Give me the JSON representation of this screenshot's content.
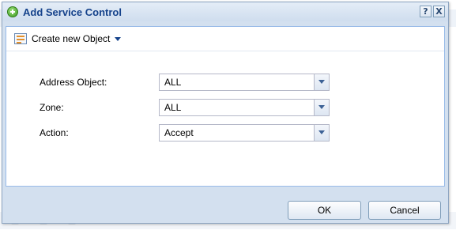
{
  "dialog": {
    "title": "Add Service Control",
    "help_label": "?",
    "close_label": "X"
  },
  "toolbar": {
    "create_label": "Create new Object"
  },
  "form": {
    "address_object": {
      "label": "Address Object:",
      "value": "ALL"
    },
    "zone": {
      "label": "Zone:",
      "value": "ALL"
    },
    "action": {
      "label": "Action:",
      "value": "Accept"
    }
  },
  "buttons": {
    "ok": "OK",
    "cancel": "Cancel"
  },
  "colors": {
    "title_text": "#15428b",
    "dialog_frame": "#d3e0ef",
    "panel_border": "#99bbe8"
  },
  "icons": {
    "title": "add-circle-icon",
    "create": "object-list-icon",
    "dropdown": "chevron-down-icon"
  }
}
